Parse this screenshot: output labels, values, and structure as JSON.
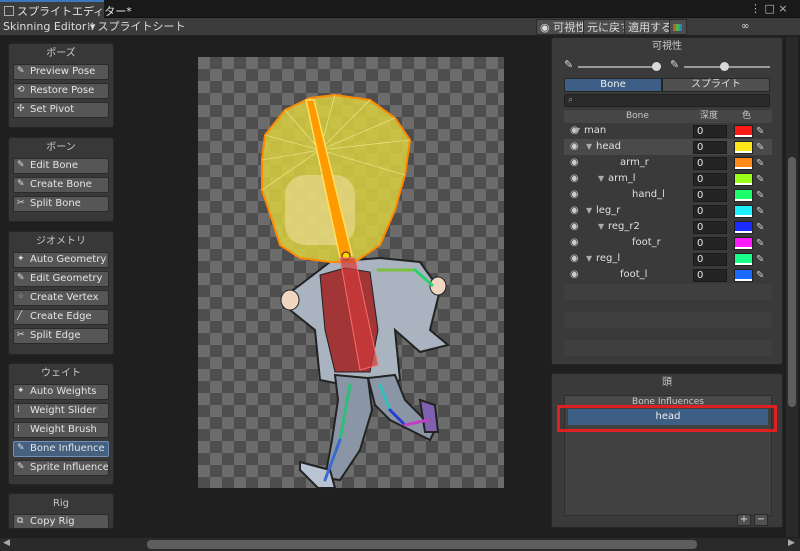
{
  "window": {
    "tab_title": "スプライトエディター*",
    "controls": "⋮ □ ×"
  },
  "toolbar": {
    "mode_dropdown": "Skinning Editor ▾",
    "sprite_sheet": "スプライトシート",
    "visibility_toggle": "可視性",
    "revert": "元に戻す",
    "apply": "適用する"
  },
  "left_panels": {
    "pose": {
      "title": "ポーズ",
      "buttons": [
        "Preview Pose",
        "Restore Pose",
        "Set Pivot"
      ]
    },
    "bone": {
      "title": "ボーン",
      "buttons": [
        "Edit Bone",
        "Create Bone",
        "Split Bone"
      ]
    },
    "geometry": {
      "title": "ジオメトリ",
      "buttons": [
        "Auto Geometry",
        "Edit Geometry",
        "Create Vertex",
        "Create Edge",
        "Split Edge"
      ]
    },
    "weight": {
      "title": "ウェイト",
      "buttons": [
        "Auto Weights",
        "Weight Slider",
        "Weight Brush",
        "Bone Influence",
        "Sprite Influence"
      ],
      "active_index": 3
    },
    "rig": {
      "title": "Rig",
      "buttons": [
        "Copy Rig"
      ]
    }
  },
  "visibility_panel": {
    "title": "可視性",
    "tabs": [
      "Bone",
      "スプライト"
    ],
    "active_tab": 0,
    "columns": [
      "Bone",
      "深度",
      "色"
    ],
    "rows": [
      {
        "name": "man",
        "expanded": true,
        "depth": "0",
        "color": "#ff1a1a",
        "selected": false
      },
      {
        "name": "head",
        "expanded": true,
        "depth": "0",
        "color": "#ffe81a",
        "selected": true
      },
      {
        "name": "arm_r",
        "expanded": false,
        "depth": "0",
        "color": "#ff8a1a",
        "selected": false
      },
      {
        "name": "arm_l",
        "expanded": true,
        "depth": "0",
        "color": "#9aff1a",
        "selected": false
      },
      {
        "name": "hand_l",
        "expanded": false,
        "depth": "0",
        "color": "#1aff6a",
        "selected": false
      },
      {
        "name": "leg_r",
        "expanded": true,
        "depth": "0",
        "color": "#1af0ff",
        "selected": false
      },
      {
        "name": "reg_r2",
        "expanded": true,
        "depth": "0",
        "color": "#1a2cff",
        "selected": false
      },
      {
        "name": "foot_r",
        "expanded": false,
        "depth": "0",
        "color": "#ff1aff",
        "selected": false
      },
      {
        "name": "reg_l",
        "expanded": true,
        "depth": "0",
        "color": "#1aff8a",
        "selected": false
      },
      {
        "name": "foot_l",
        "expanded": false,
        "depth": "0",
        "color": "#1a6aff",
        "selected": false
      }
    ]
  },
  "influence_panel": {
    "title": "頭",
    "list_header": "Bone Influences",
    "items": [
      "head"
    ],
    "add": "+",
    "remove": "−"
  },
  "colors": {
    "accent": "#3e5f85",
    "highlight_box": "#e02020",
    "selected_bone": "#ffd400"
  }
}
